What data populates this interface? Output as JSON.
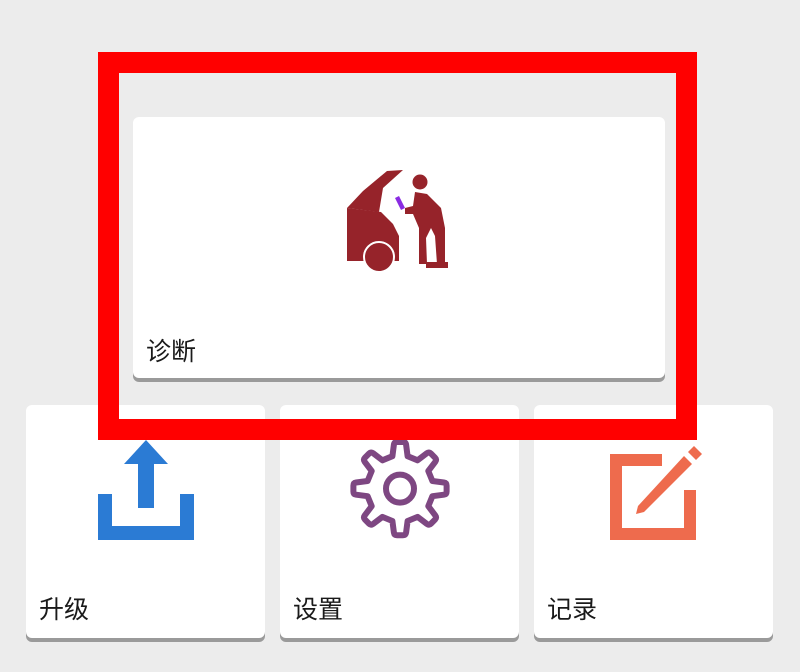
{
  "tiles": {
    "diagnose": {
      "label": "诊断",
      "icon": "car-mechanic-icon",
      "color": "#96232a"
    },
    "upgrade": {
      "label": "升级",
      "icon": "upload-icon",
      "color": "#2b7bd4"
    },
    "settings": {
      "label": "设置",
      "icon": "gear-icon",
      "color": "#7e4782"
    },
    "records": {
      "label": "记录",
      "icon": "edit-record-icon",
      "color": "#ee6b4d"
    }
  },
  "highlight": {
    "color": "#ff0000"
  }
}
